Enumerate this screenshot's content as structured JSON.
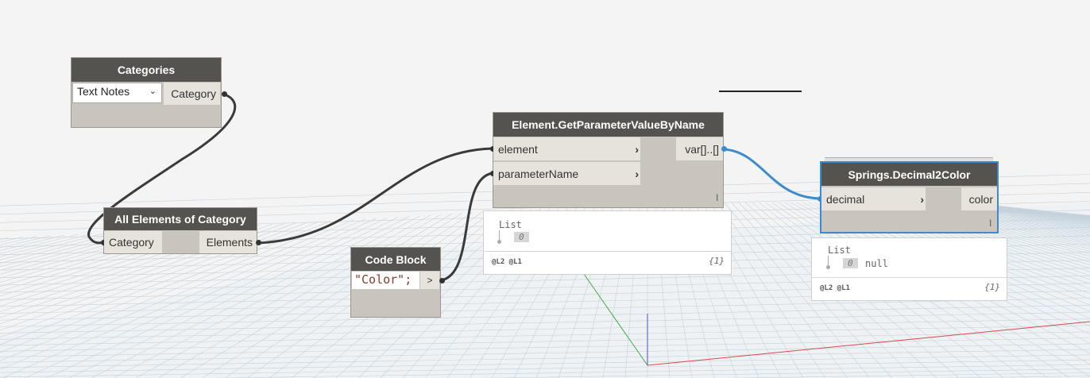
{
  "nodes": {
    "categories": {
      "title": "Categories",
      "dropdown_value": "Text Notes",
      "output_port": "Category"
    },
    "all_elements": {
      "title": "All Elements of Category",
      "input_port": "Category",
      "output_port": "Elements"
    },
    "code_block": {
      "title": "Code Block",
      "code": "\"Color\";",
      "output_port": ">"
    },
    "get_param": {
      "title": "Element.GetParameterValueByName",
      "input_ports": [
        "element",
        "parameterName"
      ],
      "output_port": "var[]..[]",
      "lacing_mark": "l",
      "preview": {
        "title": "List",
        "index": "0",
        "levels": "@L2 @L1",
        "count": "{1}"
      }
    },
    "decimal2color": {
      "title": "Springs.Decimal2Color",
      "input_port": "decimal",
      "output_port": "color",
      "lacing_mark": "l",
      "preview": {
        "title": "List",
        "index": "0",
        "value": "null",
        "levels": "@L2 @L1",
        "count": "{1}"
      }
    }
  },
  "colors": {
    "selected_accent": "#3d8bcd",
    "node_header": "#555350",
    "node_body": "#c9c5bd",
    "wire": "#3a3a3a"
  }
}
